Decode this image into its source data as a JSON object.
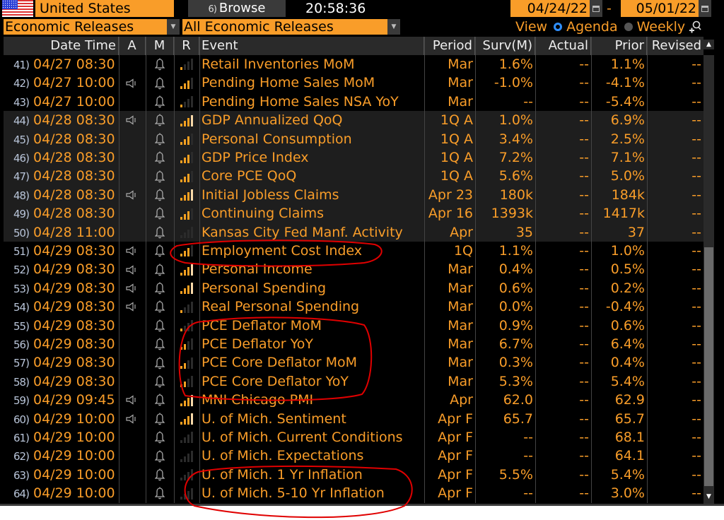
{
  "topbar": {
    "country": "United States",
    "browse_num": "6)",
    "browse_label": "Browse",
    "clock": "20:58:36",
    "date_from": "04/24/22",
    "date_sep": "-",
    "date_to": "05/01/22"
  },
  "filters": {
    "category": "Economic Releases",
    "subcategory": "All Economic Releases",
    "view_label": "View",
    "view_options": [
      "Agenda",
      "Weekly"
    ],
    "view_selected": "Agenda"
  },
  "colors": {
    "accent": "#f99d29",
    "background": "#000000",
    "shaded_row": "#1e1e1e",
    "annotation": "#e00000"
  },
  "table": {
    "headers": {
      "datetime": "Date Time",
      "a": "A",
      "m": "M",
      "r": "R",
      "event": "Event",
      "period": "Period",
      "survey": "Surv(M)",
      "actual": "Actual",
      "prior": "Prior",
      "revised": "Revised"
    },
    "rows": [
      {
        "num": "41)",
        "datetime": "04/27 08:30",
        "audio": false,
        "relevance": 0.25,
        "event": "Retail Inventories MoM",
        "period": "Mar",
        "survey": "1.6%",
        "actual": "--",
        "prior": "1.1%",
        "revised": "--",
        "shaded": false
      },
      {
        "num": "42)",
        "datetime": "04/27 10:00",
        "audio": true,
        "relevance": 0.75,
        "event": "Pending Home Sales MoM",
        "period": "Mar",
        "survey": "-1.0%",
        "actual": "--",
        "prior": "-4.1%",
        "revised": "--",
        "shaded": false
      },
      {
        "num": "43)",
        "datetime": "04/27 10:00",
        "audio": false,
        "relevance": 0.25,
        "event": "Pending Home Sales NSA YoY",
        "period": "Mar",
        "survey": "--",
        "actual": "--",
        "prior": "-5.4%",
        "revised": "--",
        "shaded": false
      },
      {
        "num": "44)",
        "datetime": "04/28 08:30",
        "audio": true,
        "relevance": 1.0,
        "event": "GDP Annualized QoQ",
        "period": "1Q A",
        "survey": "1.0%",
        "actual": "--",
        "prior": "6.9%",
        "revised": "--",
        "shaded": true
      },
      {
        "num": "45)",
        "datetime": "04/28 08:30",
        "audio": false,
        "relevance": 0.75,
        "event": "Personal Consumption",
        "period": "1Q A",
        "survey": "3.4%",
        "actual": "--",
        "prior": "2.5%",
        "revised": "--",
        "shaded": true
      },
      {
        "num": "46)",
        "datetime": "04/28 08:30",
        "audio": false,
        "relevance": 0.75,
        "event": "GDP Price Index",
        "period": "1Q A",
        "survey": "7.2%",
        "actual": "--",
        "prior": "7.1%",
        "revised": "--",
        "shaded": true
      },
      {
        "num": "47)",
        "datetime": "04/28 08:30",
        "audio": false,
        "relevance": 0.75,
        "event": "Core PCE QoQ",
        "period": "1Q A",
        "survey": "5.6%",
        "actual": "--",
        "prior": "5.0%",
        "revised": "--",
        "shaded": true
      },
      {
        "num": "48)",
        "datetime": "04/28 08:30",
        "audio": true,
        "relevance": 1.0,
        "event": "Initial Jobless Claims",
        "period": "Apr 23",
        "survey": "180k",
        "actual": "--",
        "prior": "184k",
        "revised": "--",
        "shaded": true
      },
      {
        "num": "49)",
        "datetime": "04/28 08:30",
        "audio": false,
        "relevance": 0.75,
        "event": "Continuing Claims",
        "period": "Apr 16",
        "survey": "1393k",
        "actual": "--",
        "prior": "1417k",
        "revised": "--",
        "shaded": true
      },
      {
        "num": "50)",
        "datetime": "04/28 11:00",
        "audio": false,
        "relevance": 0,
        "event": "Kansas City Fed Manf. Activity",
        "period": "Apr",
        "survey": "35",
        "actual": "--",
        "prior": "37",
        "revised": "--",
        "shaded": true
      },
      {
        "num": "51)",
        "datetime": "04/29 08:30",
        "audio": true,
        "relevance": 0.75,
        "event": "Employment Cost Index",
        "period": "1Q",
        "survey": "1.1%",
        "actual": "--",
        "prior": "1.0%",
        "revised": "--",
        "shaded": false
      },
      {
        "num": "52)",
        "datetime": "04/29 08:30",
        "audio": true,
        "relevance": 1.0,
        "event": "Personal Income",
        "period": "Mar",
        "survey": "0.4%",
        "actual": "--",
        "prior": "0.5%",
        "revised": "--",
        "shaded": false
      },
      {
        "num": "53)",
        "datetime": "04/29 08:30",
        "audio": true,
        "relevance": 1.0,
        "event": "Personal Spending",
        "period": "Mar",
        "survey": "0.6%",
        "actual": "--",
        "prior": "0.2%",
        "revised": "--",
        "shaded": false
      },
      {
        "num": "54)",
        "datetime": "04/29 08:30",
        "audio": true,
        "relevance": 0.25,
        "event": "Real Personal Spending",
        "period": "Mar",
        "survey": "0.0%",
        "actual": "--",
        "prior": "-0.4%",
        "revised": "--",
        "shaded": false
      },
      {
        "num": "55)",
        "datetime": "04/29 08:30",
        "audio": false,
        "relevance": 0.25,
        "event": "PCE Deflator MoM",
        "period": "Mar",
        "survey": "0.9%",
        "actual": "--",
        "prior": "0.6%",
        "revised": "--",
        "shaded": false
      },
      {
        "num": "56)",
        "datetime": "04/29 08:30",
        "audio": false,
        "relevance": 0.5,
        "event": "PCE Deflator YoY",
        "period": "Mar",
        "survey": "6.7%",
        "actual": "--",
        "prior": "6.4%",
        "revised": "--",
        "shaded": false
      },
      {
        "num": "57)",
        "datetime": "04/29 08:30",
        "audio": false,
        "relevance": 0.5,
        "event": "PCE Core Deflator MoM",
        "period": "Mar",
        "survey": "0.3%",
        "actual": "--",
        "prior": "0.4%",
        "revised": "--",
        "shaded": false
      },
      {
        "num": "58)",
        "datetime": "04/29 08:30",
        "audio": false,
        "relevance": 0.5,
        "event": "PCE Core Deflator YoY",
        "period": "Mar",
        "survey": "5.3%",
        "actual": "--",
        "prior": "5.4%",
        "revised": "--",
        "shaded": false
      },
      {
        "num": "59)",
        "datetime": "04/29 09:45",
        "audio": true,
        "relevance": 1.0,
        "event": "MNI Chicago PMI",
        "period": "Apr",
        "survey": "62.0",
        "actual": "--",
        "prior": "62.9",
        "revised": "--",
        "shaded": false
      },
      {
        "num": "60)",
        "datetime": "04/29 10:00",
        "audio": true,
        "relevance": 1.0,
        "event": "U. of Mich. Sentiment",
        "period": "Apr F",
        "survey": "65.7",
        "actual": "--",
        "prior": "65.7",
        "revised": "--",
        "shaded": false
      },
      {
        "num": "61)",
        "datetime": "04/29 10:00",
        "audio": false,
        "relevance": 0,
        "event": "U. of Mich. Current Conditions",
        "period": "Apr F",
        "survey": "--",
        "actual": "--",
        "prior": "68.1",
        "revised": "--",
        "shaded": false
      },
      {
        "num": "62)",
        "datetime": "04/29 10:00",
        "audio": false,
        "relevance": 0,
        "event": "U. of Mich. Expectations",
        "period": "Apr F",
        "survey": "--",
        "actual": "--",
        "prior": "64.1",
        "revised": "--",
        "shaded": false
      },
      {
        "num": "63)",
        "datetime": "04/29 10:00",
        "audio": false,
        "relevance": 0,
        "event": "U. of Mich. 1 Yr Inflation",
        "period": "Apr F",
        "survey": "5.5%",
        "actual": "--",
        "prior": "5.4%",
        "revised": "--",
        "shaded": false
      },
      {
        "num": "64)",
        "datetime": "04/29 10:00",
        "audio": false,
        "relevance": 0,
        "event": "U. of Mich. 5-10 Yr Inflation",
        "period": "Apr F",
        "survey": "--",
        "actual": "--",
        "prior": "3.0%",
        "revised": "--",
        "shaded": false
      }
    ]
  },
  "annotations": {
    "circled_events": [
      "Employment Cost Index",
      "PCE Deflator MoM",
      "PCE Deflator YoY",
      "PCE Core Deflator MoM",
      "PCE Core Deflator YoY",
      "U. of Mich. 1 Yr Inflation",
      "U. of Mich. 5-10 Yr Inflation"
    ]
  }
}
